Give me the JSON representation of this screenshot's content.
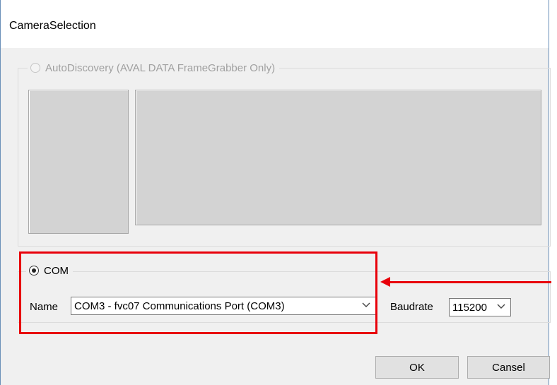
{
  "window": {
    "title": "CameraSelection"
  },
  "auto_discovery": {
    "label": "AutoDiscovery (AVAL DATA FrameGrabber Only)",
    "enabled": false,
    "selected": false
  },
  "com": {
    "label": "COM",
    "selected": true,
    "name_label": "Name",
    "name_value": "COM3 - fvc07 Communications Port (COM3)",
    "baudrate_label": "Baudrate",
    "baudrate_value": "115200"
  },
  "buttons": {
    "ok": "OK",
    "cancel": "Cansel"
  },
  "annotation": {
    "highlight_color": "#e8000a"
  },
  "icons": {
    "dropdown": "chevron-down-icon",
    "radio": "radio-icon"
  }
}
